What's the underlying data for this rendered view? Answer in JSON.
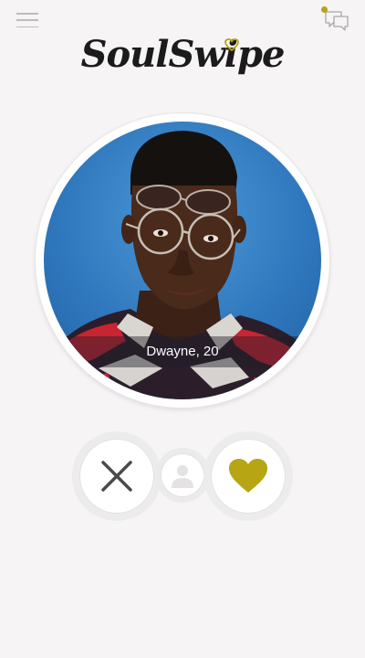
{
  "header": {
    "logo_text": "SoulSwipe",
    "menu_icon": "hamburger-menu-icon",
    "chat_icon": "chat-bubbles-icon",
    "accent_color": "#b7a514"
  },
  "profile": {
    "name_age": "Dwayne, 20",
    "icons": [
      "friends-icon",
      "book-icon"
    ]
  },
  "actions": {
    "reject_icon": "close-icon",
    "profile_icon": "user-silhouette-icon",
    "like_icon": "heart-icon"
  }
}
